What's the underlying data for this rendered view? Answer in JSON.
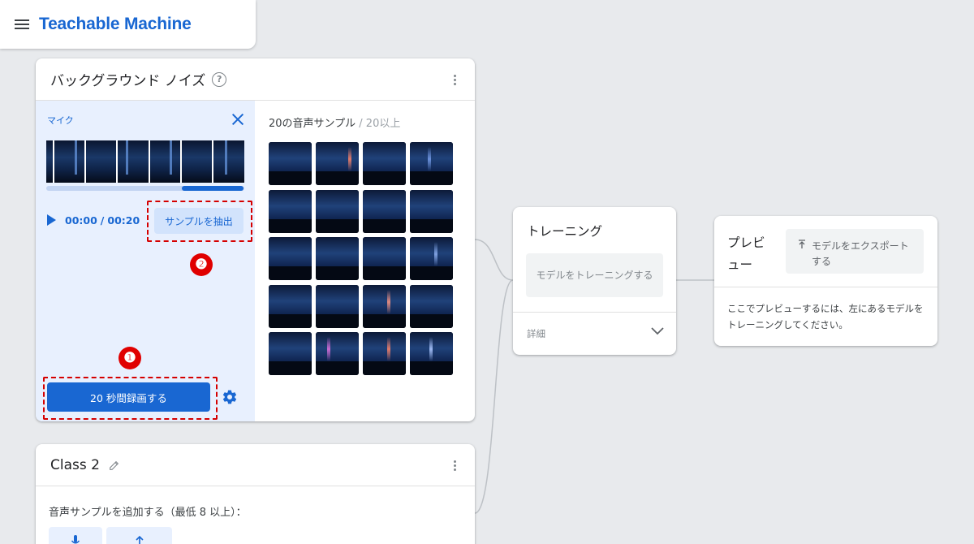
{
  "app": {
    "title": "Teachable Machine",
    "menu_icon": "hamburger-icon"
  },
  "class1": {
    "title": "バックグラウンド ノイズ",
    "help_glyph": "?",
    "recorder": {
      "mic_label": "マイク",
      "time_current": "00:00",
      "time_separator": "/",
      "time_total": "00:20",
      "extract_button": "サンプルを抽出",
      "record_button": "20 秒間録画する"
    },
    "samples": {
      "count_label": "20の音声サンプル",
      "min_label": " / 20以上",
      "sample_count": 20
    }
  },
  "annotations": {
    "marker_1": "❶",
    "marker_2": "❷",
    "accent_color": "#e00000"
  },
  "class2": {
    "title": "Class 2",
    "add_label": "音声サンプルを追加する（最低 8 以上）："
  },
  "training": {
    "title": "トレーニング",
    "train_button": "モデルをトレーニングする",
    "details_label": "詳細"
  },
  "preview": {
    "title": "プレビュー",
    "export_button": "モデルをエクスポートする",
    "message": "ここでプレビューするには、左にあるモデルをトレーニングしてください。"
  },
  "colors": {
    "primary": "#1967d2",
    "primary_light": "#e8f0fe",
    "background": "#e8eaed"
  }
}
